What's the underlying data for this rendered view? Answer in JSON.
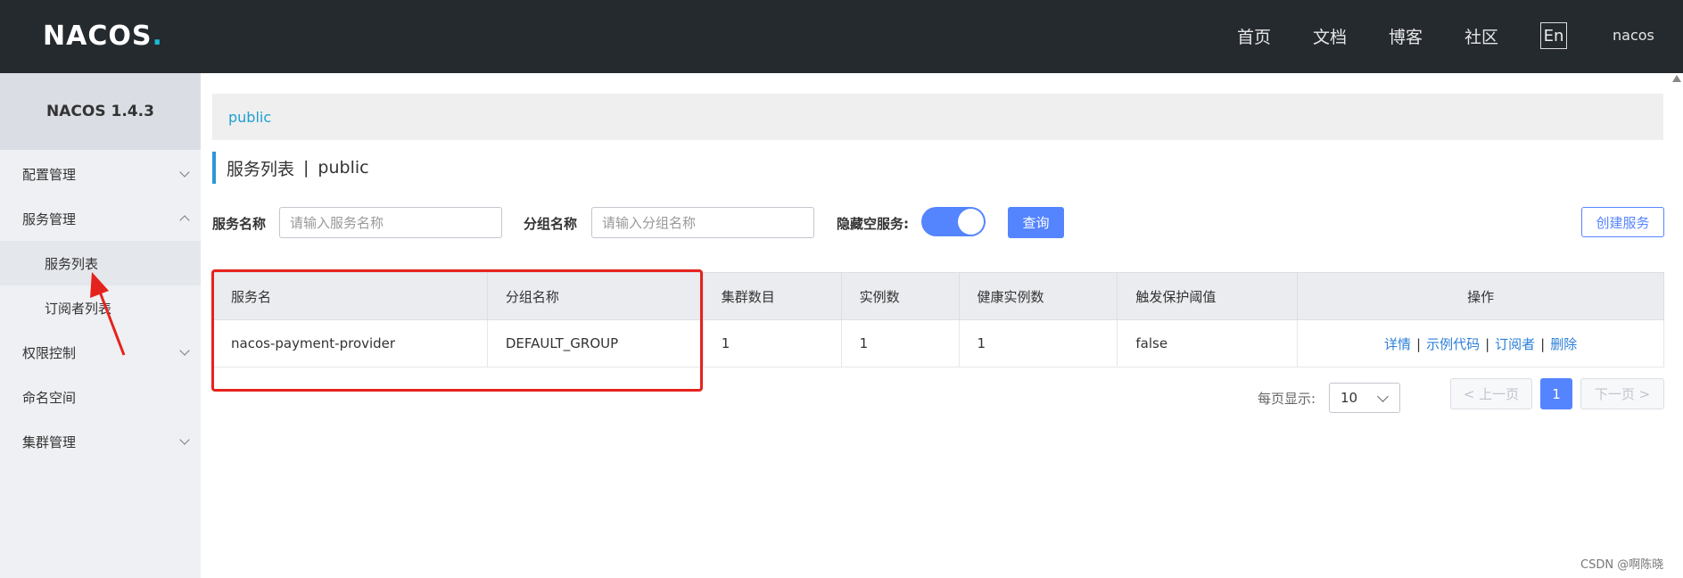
{
  "header": {
    "logo_main": "NACOS",
    "logo_dot": ".",
    "nav": [
      "首页",
      "文档",
      "博客",
      "社区"
    ],
    "lang": "En",
    "user": "nacos"
  },
  "sidebar": {
    "title": "NACOS 1.4.3",
    "items": [
      {
        "label": "配置管理"
      },
      {
        "label": "服务管理"
      },
      {
        "label": "服务列表"
      },
      {
        "label": "订阅者列表"
      },
      {
        "label": "权限控制"
      },
      {
        "label": "命名空间"
      },
      {
        "label": "集群管理"
      }
    ]
  },
  "breadcrumb": "public",
  "page": {
    "title": "服务列表",
    "separator": "|",
    "namespace": "public"
  },
  "filters": {
    "service_label": "服务名称",
    "service_placeholder": "请输入服务名称",
    "group_label": "分组名称",
    "group_placeholder": "请输入分组名称",
    "hide_empty_label": "隐藏空服务:",
    "hide_empty_on": true,
    "search_button": "查询",
    "create_button": "创建服务"
  },
  "table": {
    "columns": [
      "服务名",
      "分组名称",
      "集群数目",
      "实例数",
      "健康实例数",
      "触发保护阈值",
      "操作"
    ],
    "rows": [
      {
        "service": "nacos-payment-provider",
        "group": "DEFAULT_GROUP",
        "clusters": "1",
        "instances": "1",
        "healthy": "1",
        "threshold": "false",
        "ops": [
          "详情",
          "示例代码",
          "订阅者",
          "删除"
        ]
      }
    ]
  },
  "pagination": {
    "per_page_label": "每页显示:",
    "per_page_value": "10",
    "prev": "上一页",
    "current": "1",
    "next": "下一页"
  },
  "watermark": "CSDN @啊陈晓",
  "colors": {
    "header_bg": "#252a2f",
    "primary": "#5584ff",
    "link": "#2d7fd8",
    "annotation": "#e5231e"
  }
}
